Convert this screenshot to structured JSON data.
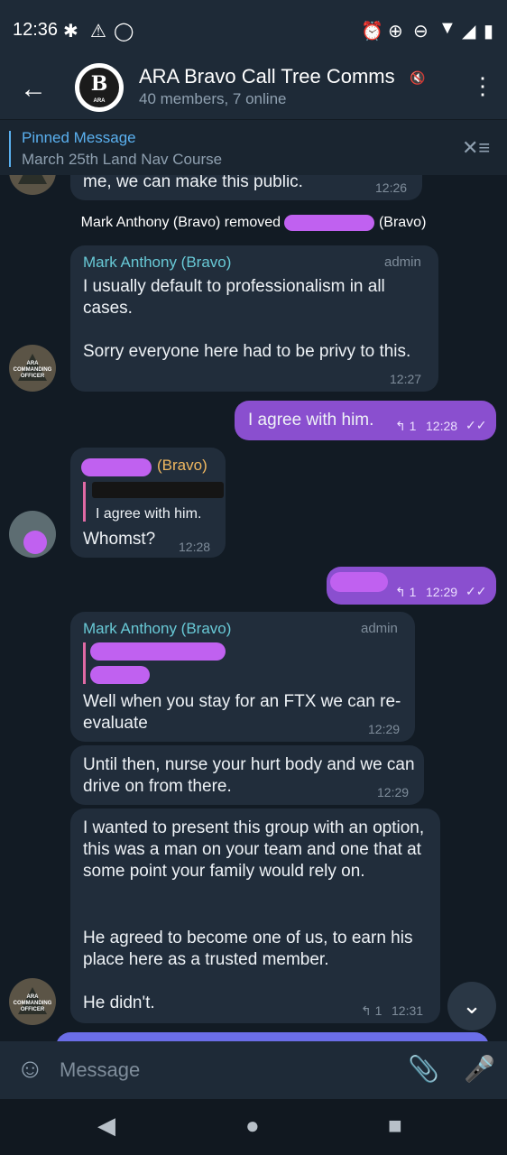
{
  "status_bar": {
    "time": "12:36",
    "left_icons": [
      "slack-icon",
      "warning-icon",
      "loading-icon"
    ],
    "right_icons": [
      "alarm-icon",
      "data-saver-icon",
      "dnd-icon",
      "wifi-icon",
      "signal-icon",
      "battery-icon"
    ]
  },
  "header": {
    "title": "ARA Bravo Call Tree Comms",
    "subtitle": "40 members, 7 online",
    "avatar_letter": "B",
    "avatar_small": "ARA"
  },
  "pinned": {
    "label": "Pinned Message",
    "text": "March 25th Land Nav Course"
  },
  "avatar_label": "ARA COMMANDING OFFICER",
  "messages": {
    "m0": {
      "text": "me, we can make this public.",
      "time": "12:26"
    },
    "service": {
      "prefix": "Mark Anthony (Bravo) removed",
      "suffix": "(Bravo)"
    },
    "m1": {
      "sender": "Mark Anthony (Bravo)",
      "role": "admin",
      "text_a": "I usually default to professionalism in all cases.",
      "text_b": "Sorry everyone here had to be privy to this.",
      "time": "12:27"
    },
    "m2": {
      "text": "I agree with him.",
      "replies": "1",
      "time": "12:28"
    },
    "m3": {
      "sender_suffix": "(Bravo)",
      "quote": "I agree with him.",
      "text": "Whomst?",
      "time": "12:28"
    },
    "m4": {
      "replies": "1",
      "time": "12:29"
    },
    "m5": {
      "sender": "Mark Anthony (Bravo)",
      "role": "admin",
      "text": "Well when you stay for an FTX we can re-evaluate",
      "time": "12:29"
    },
    "m6": {
      "text": "Until then, nurse your hurt body and we can drive on from there.",
      "time": "12:29"
    },
    "m7": {
      "text_a": "I wanted to present this group with an option, this was a man on your team and one that at some point your family would rely on.",
      "text_b": "He agreed to become one of us, to earn his place here as a trusted member.",
      "text_c": "He didn't.",
      "replies": "1",
      "time": "12:31"
    }
  },
  "input": {
    "placeholder": "Message"
  }
}
